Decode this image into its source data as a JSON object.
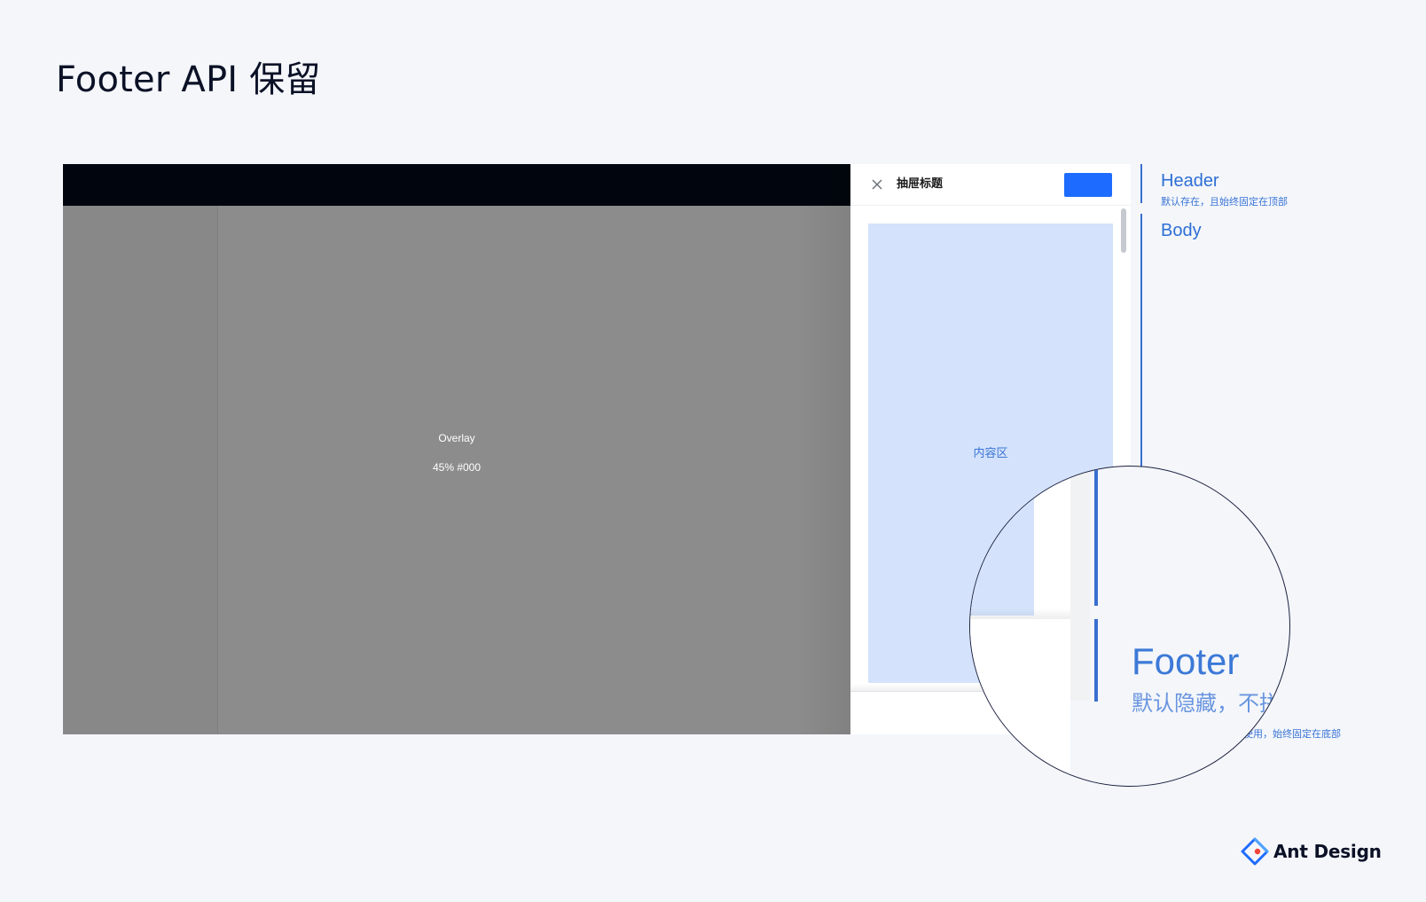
{
  "page": {
    "title": "Footer API 保留"
  },
  "overlay": {
    "name_label": "Overlay",
    "spec_label": "45% #000"
  },
  "drawer": {
    "title": "抽屉标题",
    "body_label": "内容区"
  },
  "annotations": {
    "header": {
      "title": "Header",
      "desc": "默认存在，且始终固定在顶部"
    },
    "body": {
      "title": "Body"
    },
    "footer": {
      "title": "Footer",
      "desc_partial": "默认隐藏，不拼",
      "desc_tail": "使用，始终固定在底部"
    }
  },
  "brand": {
    "name": "Ant Design"
  },
  "colors": {
    "background": "#f4f6fa",
    "overlay": "rgba(0,0,0,0.45)",
    "topbar": "#020b1a",
    "primary_button": "#1e6cff",
    "content_block": "#d4e3fb",
    "annotation_blue": "#2d6fd5"
  },
  "icons": {
    "close": "close-icon",
    "brand": "ant-design-logo-icon"
  }
}
